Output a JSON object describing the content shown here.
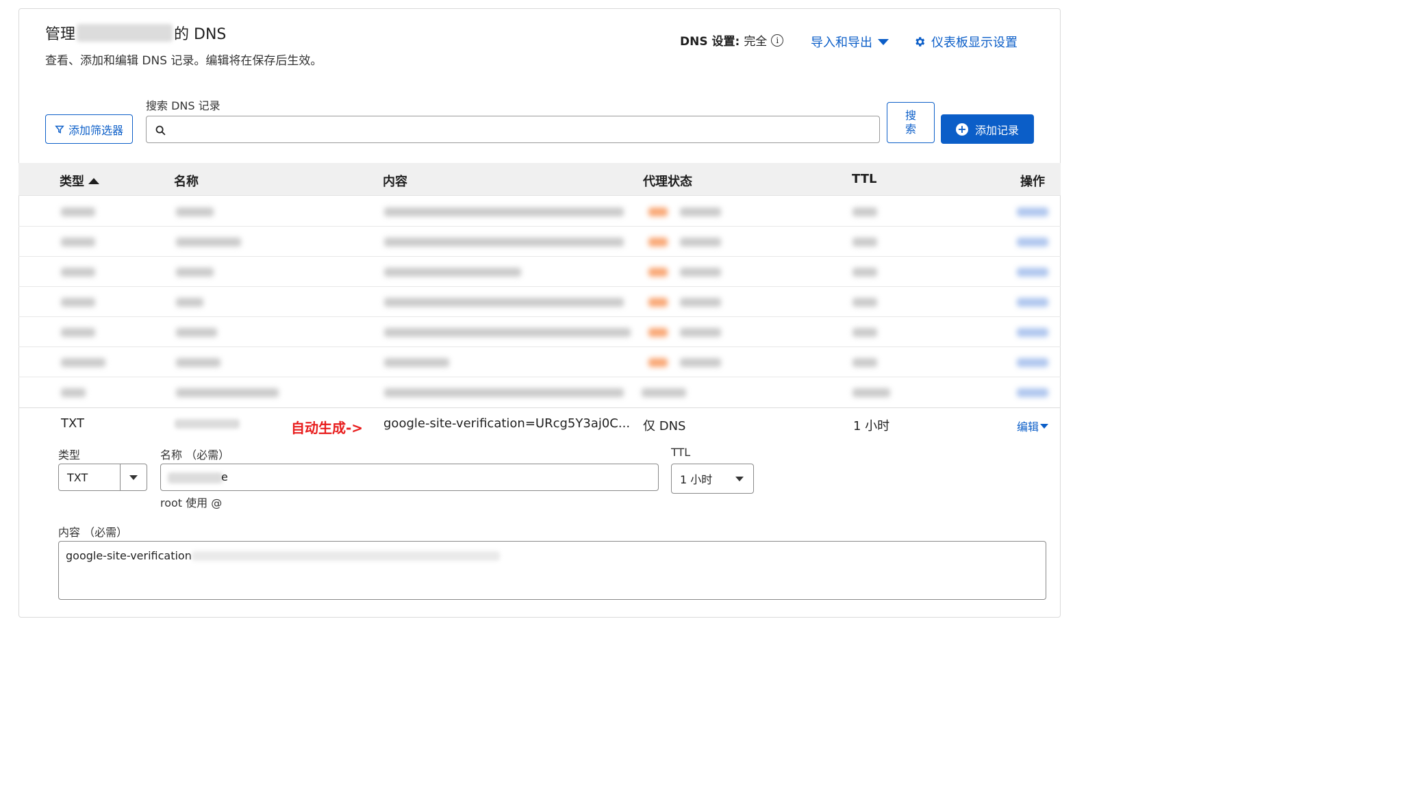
{
  "header": {
    "title_prefix": "管理",
    "title_suffix": "的 DNS",
    "subtitle": "查看、添加和编辑 DNS 记录。编辑将在保存后生效。",
    "dns_setting_label": "DNS 设置:",
    "dns_setting_value": "完全",
    "import_export": "导入和导出",
    "dashboard_display": "仪表板显示设置"
  },
  "toolbar": {
    "filter_button": "添加筛选器",
    "search_label": "搜索 DNS 记录",
    "search_placeholder": "",
    "search_button": "搜\n索",
    "add_record_button": "添加记录"
  },
  "table": {
    "columns": [
      "类型",
      "名称",
      "内容",
      "代理状态",
      "TTL",
      "操作"
    ],
    "sort_column": "类型",
    "sort_direction": "ascending",
    "expanded_row": {
      "type": "TXT",
      "content": "google-site-verification=URcg5Y3aj0C...",
      "proxy_status": "仅 DNS",
      "ttl": "1 小时",
      "action": "编辑"
    }
  },
  "annotation": {
    "text": "自动生成->",
    "color": "#e81c1c"
  },
  "edit_form": {
    "type_label": "类型",
    "type_value": "TXT",
    "name_label": "名称 （必需）",
    "name_value_visible": "e",
    "name_hint": "root 使用 @",
    "ttl_label": "TTL",
    "ttl_value": "1 小时",
    "content_label": "内容 （必需）",
    "content_value_visible": "google-site-verification"
  },
  "colors": {
    "accent": "#0b5ec8",
    "proxied_orange": "#f6823b"
  }
}
